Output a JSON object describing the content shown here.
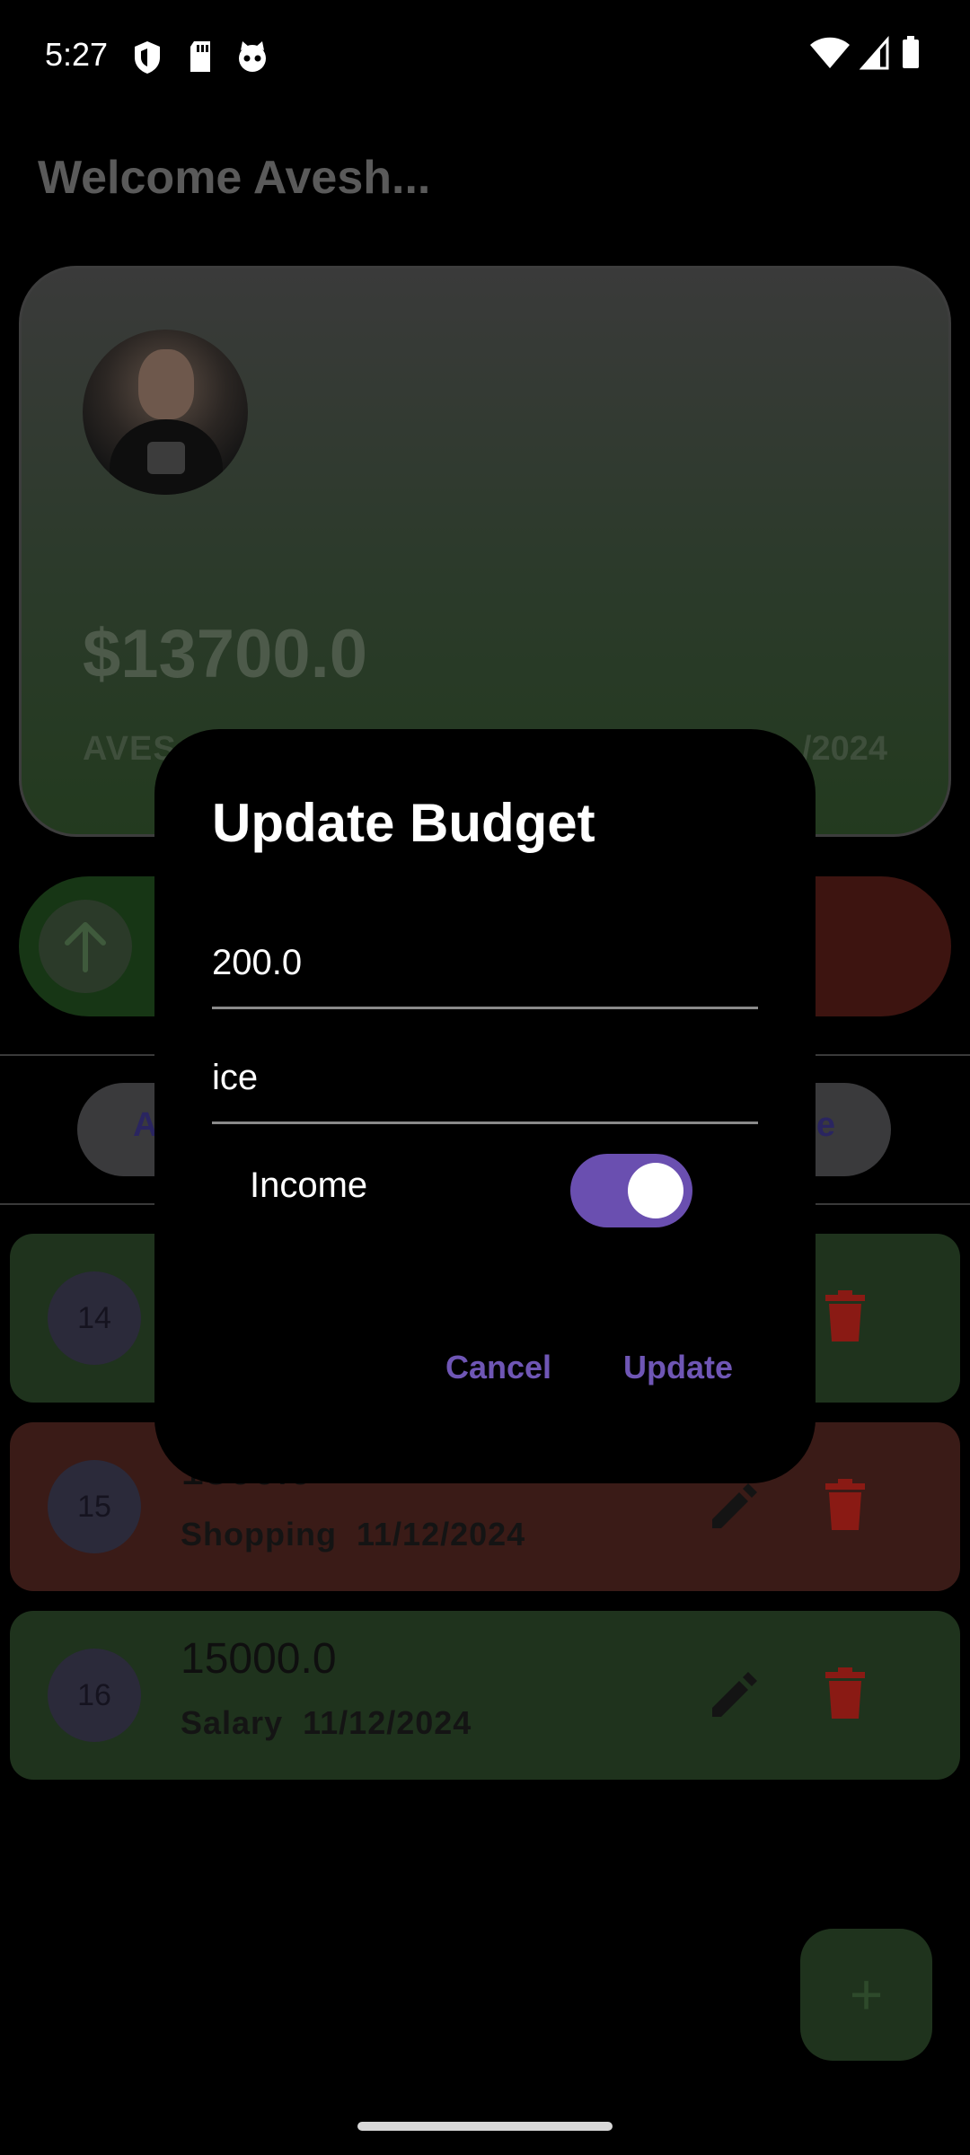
{
  "status_bar": {
    "time": "5:27",
    "left_icons": [
      "shield-icon",
      "sd-card-icon",
      "cat-face-icon"
    ],
    "right_icons": [
      "wifi-icon",
      "signal-icon",
      "battery-icon"
    ]
  },
  "header": {
    "welcome": "Welcome Avesh..."
  },
  "card": {
    "balance": "$13700.0",
    "name_visible": "AVES",
    "date_visible": "/2024"
  },
  "actions": {
    "income_icon": "arrow-up-icon"
  },
  "filters": {
    "left_visible": "A",
    "right_visible": "e"
  },
  "transactions": [
    {
      "id": "14",
      "amount": "",
      "category": "",
      "date": "",
      "type": "income"
    },
    {
      "id": "15",
      "amount": "1500.0",
      "category": "Shopping",
      "date": "11/12/2024",
      "type": "expense"
    },
    {
      "id": "16",
      "amount": "15000.0",
      "category": "Salary",
      "date": "11/12/2024",
      "type": "income"
    }
  ],
  "fab": {
    "label": "+"
  },
  "dialog": {
    "title": "Update Budget",
    "amount_value": "200.0",
    "description_value": "ice",
    "toggle_label": "Income",
    "toggle_on": true,
    "cancel_label": "Cancel",
    "update_label": "Update"
  },
  "colors": {
    "accent": "#6a4fb0",
    "income_bg": "#1f331d",
    "expense_bg": "#3a1b17",
    "delete_red": "#8a1a14"
  }
}
